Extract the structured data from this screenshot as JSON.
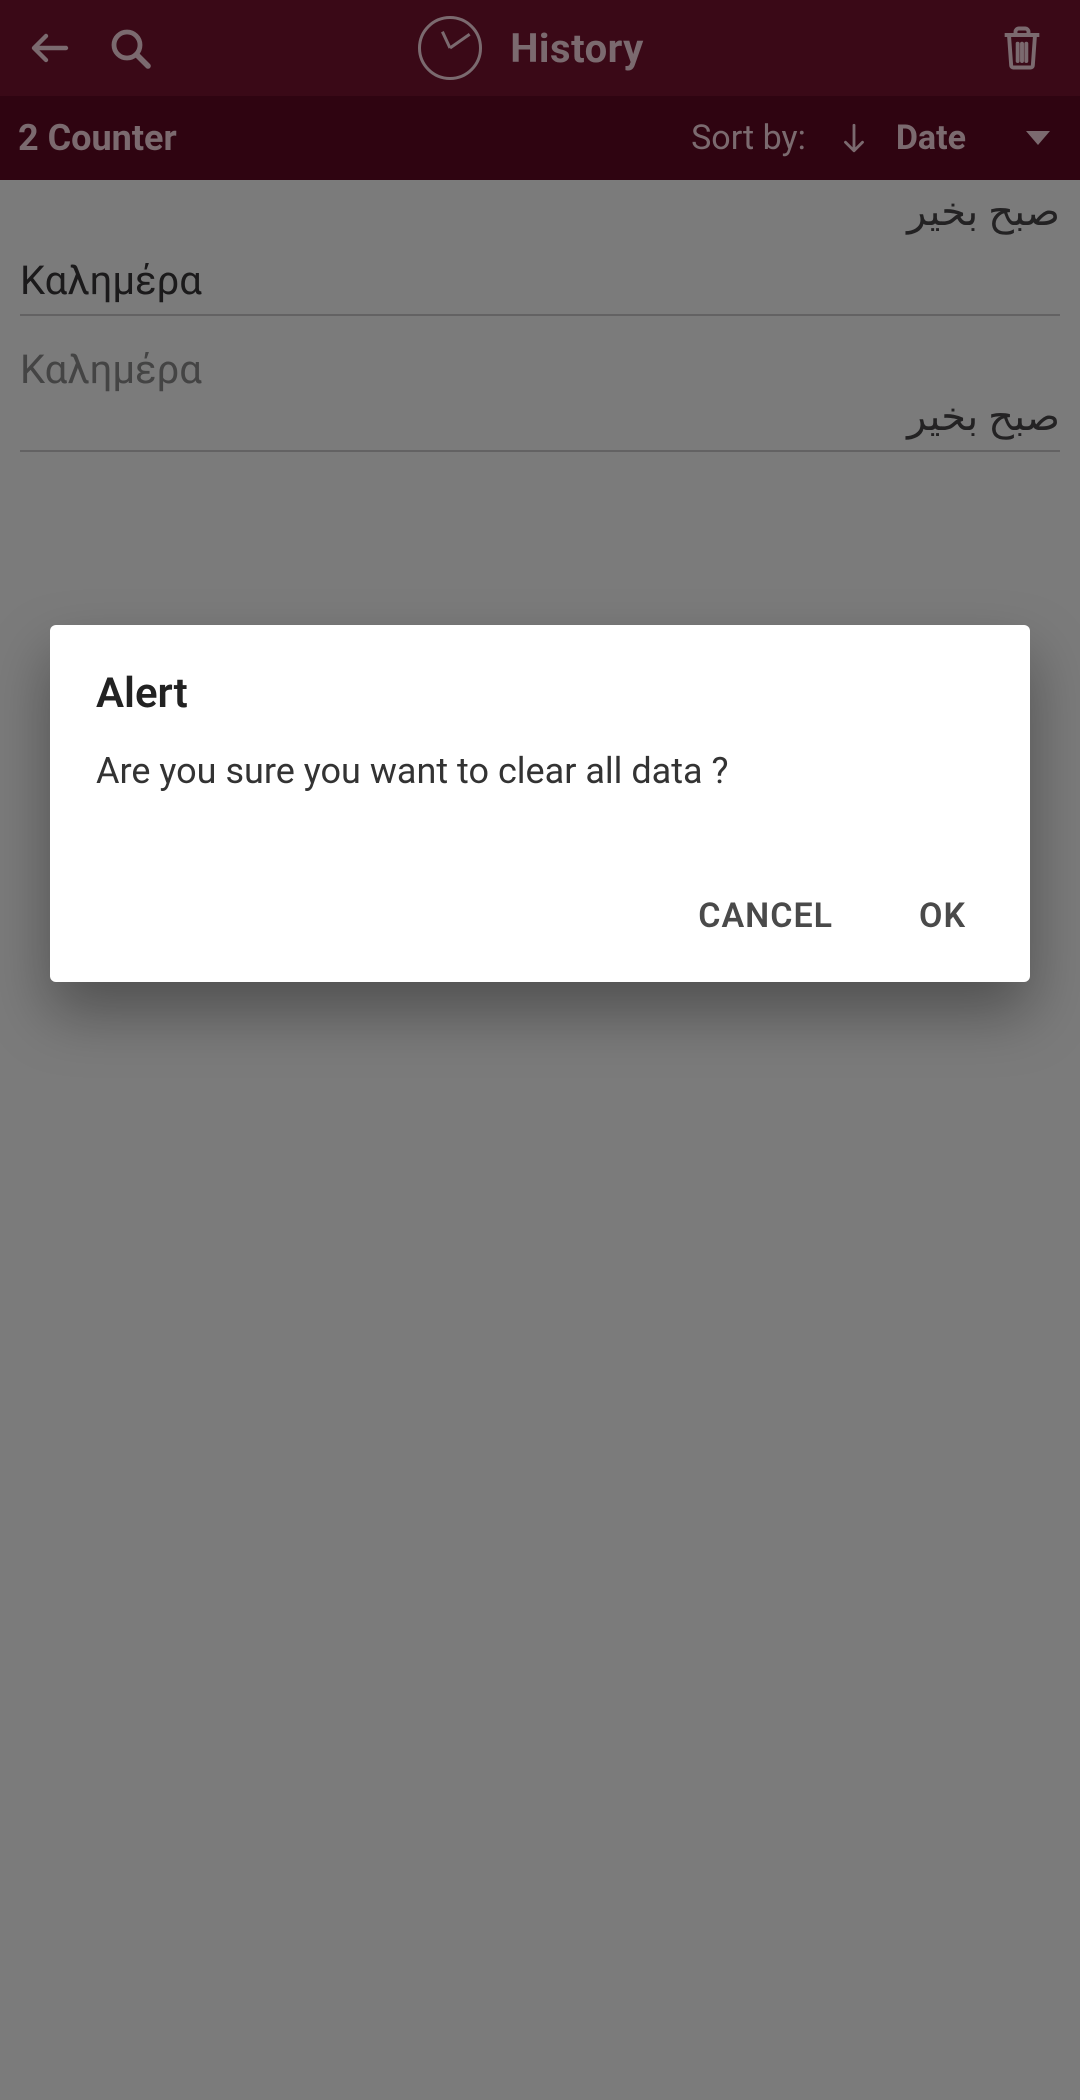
{
  "header": {
    "title": "History"
  },
  "sortbar": {
    "counter_label": "2 Counter",
    "sort_by_label": "Sort by:",
    "field_label": "Date"
  },
  "list": {
    "rows": [
      {
        "primary": "صبح بخير",
        "secondary": "Καλημέρα",
        "muted": false
      },
      {
        "primary": "صبح بخير",
        "secondary": "Καλημέρα",
        "muted": true
      }
    ]
  },
  "dialog": {
    "title": "Alert",
    "message": "Are you sure you want to clear all data ?",
    "cancel_label": "CANCEL",
    "ok_label": "OK"
  }
}
